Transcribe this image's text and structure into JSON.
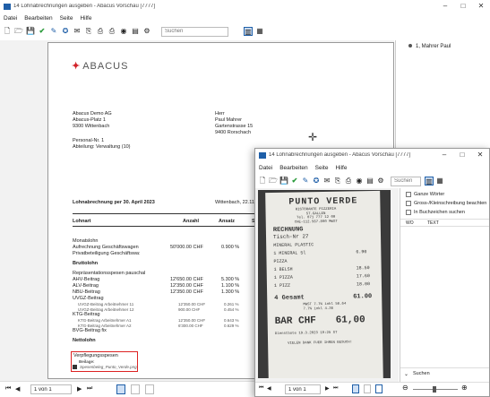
{
  "main": {
    "title": "14 Lohnabrechnungen ausgeben - Abacus Vorschau [7777]",
    "menu": [
      "Datei",
      "Bearbeiten",
      "Seite",
      "Hilfe"
    ],
    "search_placeholder": "Suchen",
    "tree_item": "1, Mahrer Paul",
    "page_field": "1 von 1",
    "doc": {
      "logo": "ABACUS",
      "sender": [
        "Abacus Demo AG",
        "Abacus-Platz 1",
        "9300 Wittenbach"
      ],
      "recipient": [
        "Herr",
        "Paul Mahrer",
        "Gartenstrasse 15",
        "9400 Rorschach"
      ],
      "personal": [
        "Personal-Nr. 1",
        "Abteilung: Verwaltung (10)"
      ],
      "heading": "Lohnabrechnung per 30. April 2023",
      "place_date": "Wittenbach, 22.11.",
      "cols": [
        "Lohnart",
        "Anzahl",
        "Ansatz",
        "S"
      ],
      "rows": [
        {
          "t": "Monatslohn",
          "a": "",
          "r": "",
          "s": "n"
        },
        {
          "t": "Aufrechnung Geschäftswagen",
          "a": "50'000.00  CHF",
          "r": "0.900  %",
          "s": "n"
        },
        {
          "t": "Privatbeteiligung Geschäftswa:",
          "a": "",
          "r": "",
          "s": "n"
        },
        {
          "t": "Bruttolohn",
          "a": "",
          "r": "",
          "s": "b"
        },
        {
          "t": "Repräsentationsspesen pauschal",
          "a": "",
          "r": "",
          "s": "n"
        },
        {
          "t": "AHV-Beitrag",
          "a": "12'650.00  CHF",
          "r": "5.300  %",
          "s": "n"
        },
        {
          "t": "ALV-Beitrag",
          "a": "12'350.00  CHF",
          "r": "1.100  %",
          "s": "n"
        },
        {
          "t": "NBU-Beitrag",
          "a": "12'350.00  CHF",
          "r": "1.300  %",
          "s": "n"
        },
        {
          "t": "UVGZ-Beitrag",
          "a": "",
          "r": "",
          "s": "n"
        },
        {
          "t": "UVGZ-Beitrag Arbeitnehmer 11",
          "a": "12'350.00  CHF",
          "r": "0.261  %",
          "s": "s"
        },
        {
          "t": "UVGZ-Beitrag Arbeitnehmer 12",
          "a": "900.00  CHF",
          "r": "0.454  %",
          "s": "s"
        },
        {
          "t": "KTG-Beitrag",
          "a": "",
          "r": "",
          "s": "n"
        },
        {
          "t": "KTG-Beitrag Arbeitnehmer A1",
          "a": "12'350.00  CHF",
          "r": "0.643  %",
          "s": "s"
        },
        {
          "t": "KTG-Beitrag Arbeitnehmer A2",
          "a": "6'300.00  CHF",
          "r": "0.629  %",
          "s": "s"
        },
        {
          "t": "BVG-Beitrag fix",
          "a": "",
          "r": "",
          "s": "n"
        },
        {
          "t": "Nettolohn",
          "a": "",
          "r": "",
          "s": "b"
        }
      ],
      "spesen": {
        "t": "Verpflegungsspesen",
        "b": "Beilage:",
        "f": "Spesenbeleg_Punto_Verde.png"
      }
    }
  },
  "popup": {
    "title": "14 Lohnabrechnungen ausgeben - Abacus Vorschau [7777]",
    "menu": [
      "Datei",
      "Bearbeiten",
      "Seite",
      "Hilfe"
    ],
    "search_placeholder": "Suchen",
    "options": [
      "Ganze Wörter",
      "Gross-/Kleinschreibung beachten",
      "In Buchzeichen suchen"
    ],
    "cols": [
      "WO",
      "TEXT"
    ],
    "find_label": "Suchen",
    "page_field": "1 von 1",
    "receipt": {
      "name": "PUNTO VERDE",
      "lines": [
        "RISTORANTE PIZZERIA",
        "ST.GALLEN",
        "Tel. 071 777 12 00",
        "CHE-112.567.890 MWST"
      ],
      "title": "RECHNUNG",
      "tisch": "Tisch-Nr  27",
      "items": [
        {
          "n": "MINERAL PLASTIC",
          "p": ""
        },
        {
          "n": "1 MINERAL 5l",
          "p": "6.90"
        },
        {
          "n": "PIZZA",
          "p": ""
        },
        {
          "n": "1 BELSH",
          "p": "18.50"
        },
        {
          "n": "1 PIZZA",
          "p": "17.60"
        },
        {
          "n": "1 PIZZ",
          "p": "18.00"
        }
      ],
      "total_label": "4 Gesamt",
      "total": "61.00",
      "vat": [
        "MWST 7.7% inkl 56.64",
        "7.7% inkl   4.36"
      ],
      "bar_label": "BAR CHF",
      "bar_value": "61,00",
      "footer": [
        "Dienstbote 19.3.2023 19:25 ST",
        "VIELEN DANK FUER IHREN BESUCH!"
      ]
    }
  }
}
